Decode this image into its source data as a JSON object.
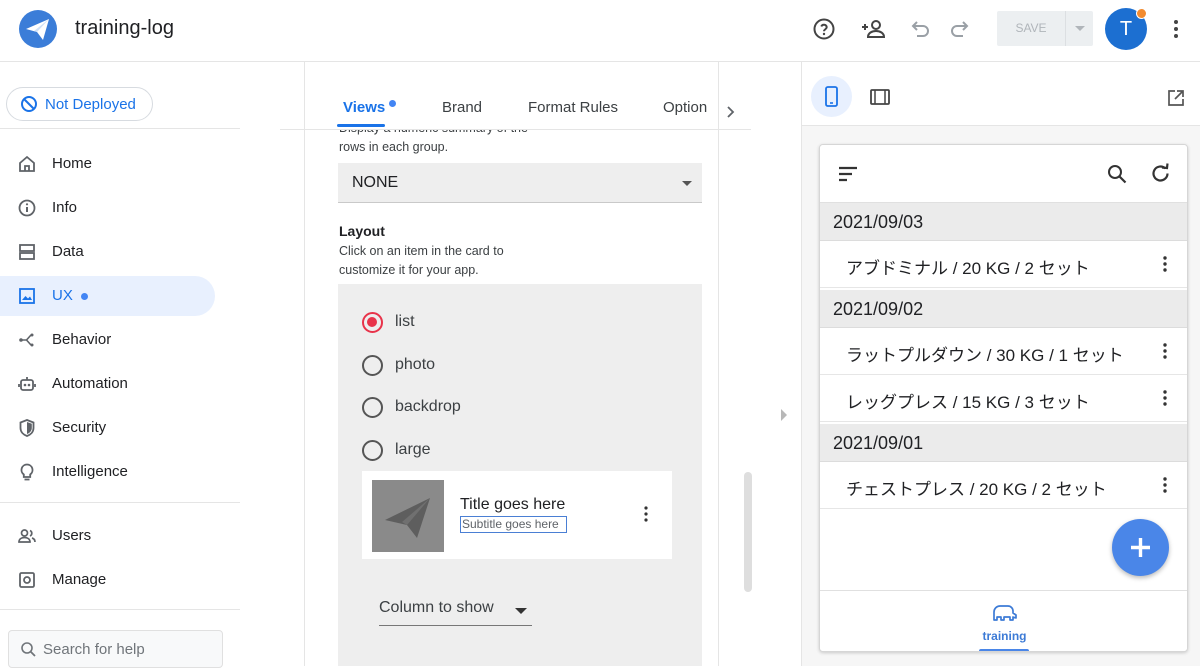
{
  "app": {
    "title": "training-log"
  },
  "toolbar": {
    "save_label": "SAVE",
    "avatar_initial": "T",
    "icons": [
      "help-icon",
      "add-person-icon",
      "undo-icon",
      "redo-icon",
      "more-vert-icon"
    ]
  },
  "sidebar": {
    "deploy_status": "Not Deployed",
    "items": [
      {
        "label": "Home",
        "icon": "home-icon"
      },
      {
        "label": "Info",
        "icon": "info-icon"
      },
      {
        "label": "Data",
        "icon": "data-icon"
      },
      {
        "label": "UX",
        "icon": "ux-icon",
        "active": true
      },
      {
        "label": "Behavior",
        "icon": "behavior-icon"
      },
      {
        "label": "Automation",
        "icon": "automation-icon"
      },
      {
        "label": "Security",
        "icon": "security-icon"
      },
      {
        "label": "Intelligence",
        "icon": "intelligence-icon"
      },
      {
        "label": "Users",
        "icon": "users-icon"
      },
      {
        "label": "Manage",
        "icon": "manage-icon"
      }
    ],
    "search_placeholder": "Search for help"
  },
  "editor": {
    "tabs": [
      "Views",
      "Brand",
      "Format Rules",
      "Option"
    ],
    "active_tab": "Views",
    "summary_desc_line1": "Display a numeric summary of the",
    "summary_desc_line2": "rows in each group.",
    "summary_value": "NONE",
    "layout_title": "Layout",
    "layout_desc_line1": "Click on an item in the card to",
    "layout_desc_line2": "customize it for your app.",
    "layout_options": [
      "list",
      "photo",
      "backdrop",
      "large"
    ],
    "layout_selected": "list",
    "card_title": "Title goes here",
    "card_subtitle": "Subtitle goes here",
    "column_to_show": "Column to show"
  },
  "preview": {
    "groups": [
      {
        "date": "2021/09/03",
        "rows": [
          "アブドミナル / 20 KG / 2 セット"
        ]
      },
      {
        "date": "2021/09/02",
        "rows": [
          "ラットプルダウン / 30 KG / 1 セット",
          "レッグプレス / 15 KG / 3 セット"
        ]
      },
      {
        "date": "2021/09/01",
        "rows": [
          "チェストプレス / 20 KG / 2 セット"
        ]
      }
    ],
    "bottom_nav_label": "training"
  },
  "colors": {
    "accent": "#1a73e8",
    "radio": "#e8334a",
    "fab": "#4a86e8",
    "avatar": "#1c6fd1"
  }
}
